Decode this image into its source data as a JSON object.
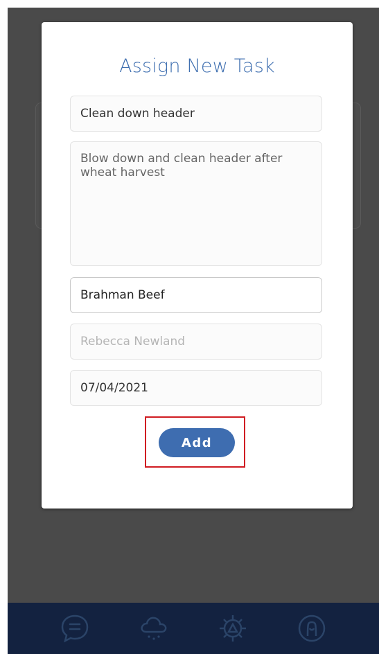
{
  "modal": {
    "title": "Assign New Task",
    "fields": {
      "task_title": "Clean down header",
      "task_description": "Blow down and clean header after wheat harvest",
      "farm": "Brahman Beef",
      "assignee_placeholder": "Rebecca Newland",
      "due_date": "07/04/2021"
    },
    "add_label": "Add"
  },
  "colors": {
    "accent": "#3e6db0",
    "title": "#3f6fb0",
    "tabbar": "#132240",
    "highlight": "#d01c22",
    "overlay": "#4a4a4a"
  },
  "tabbar": {
    "items": [
      {
        "icon": "chat-bubble-icon"
      },
      {
        "icon": "rain-cloud-icon"
      },
      {
        "icon": "gear-warning-icon"
      },
      {
        "icon": "user-profile-icon"
      }
    ]
  }
}
